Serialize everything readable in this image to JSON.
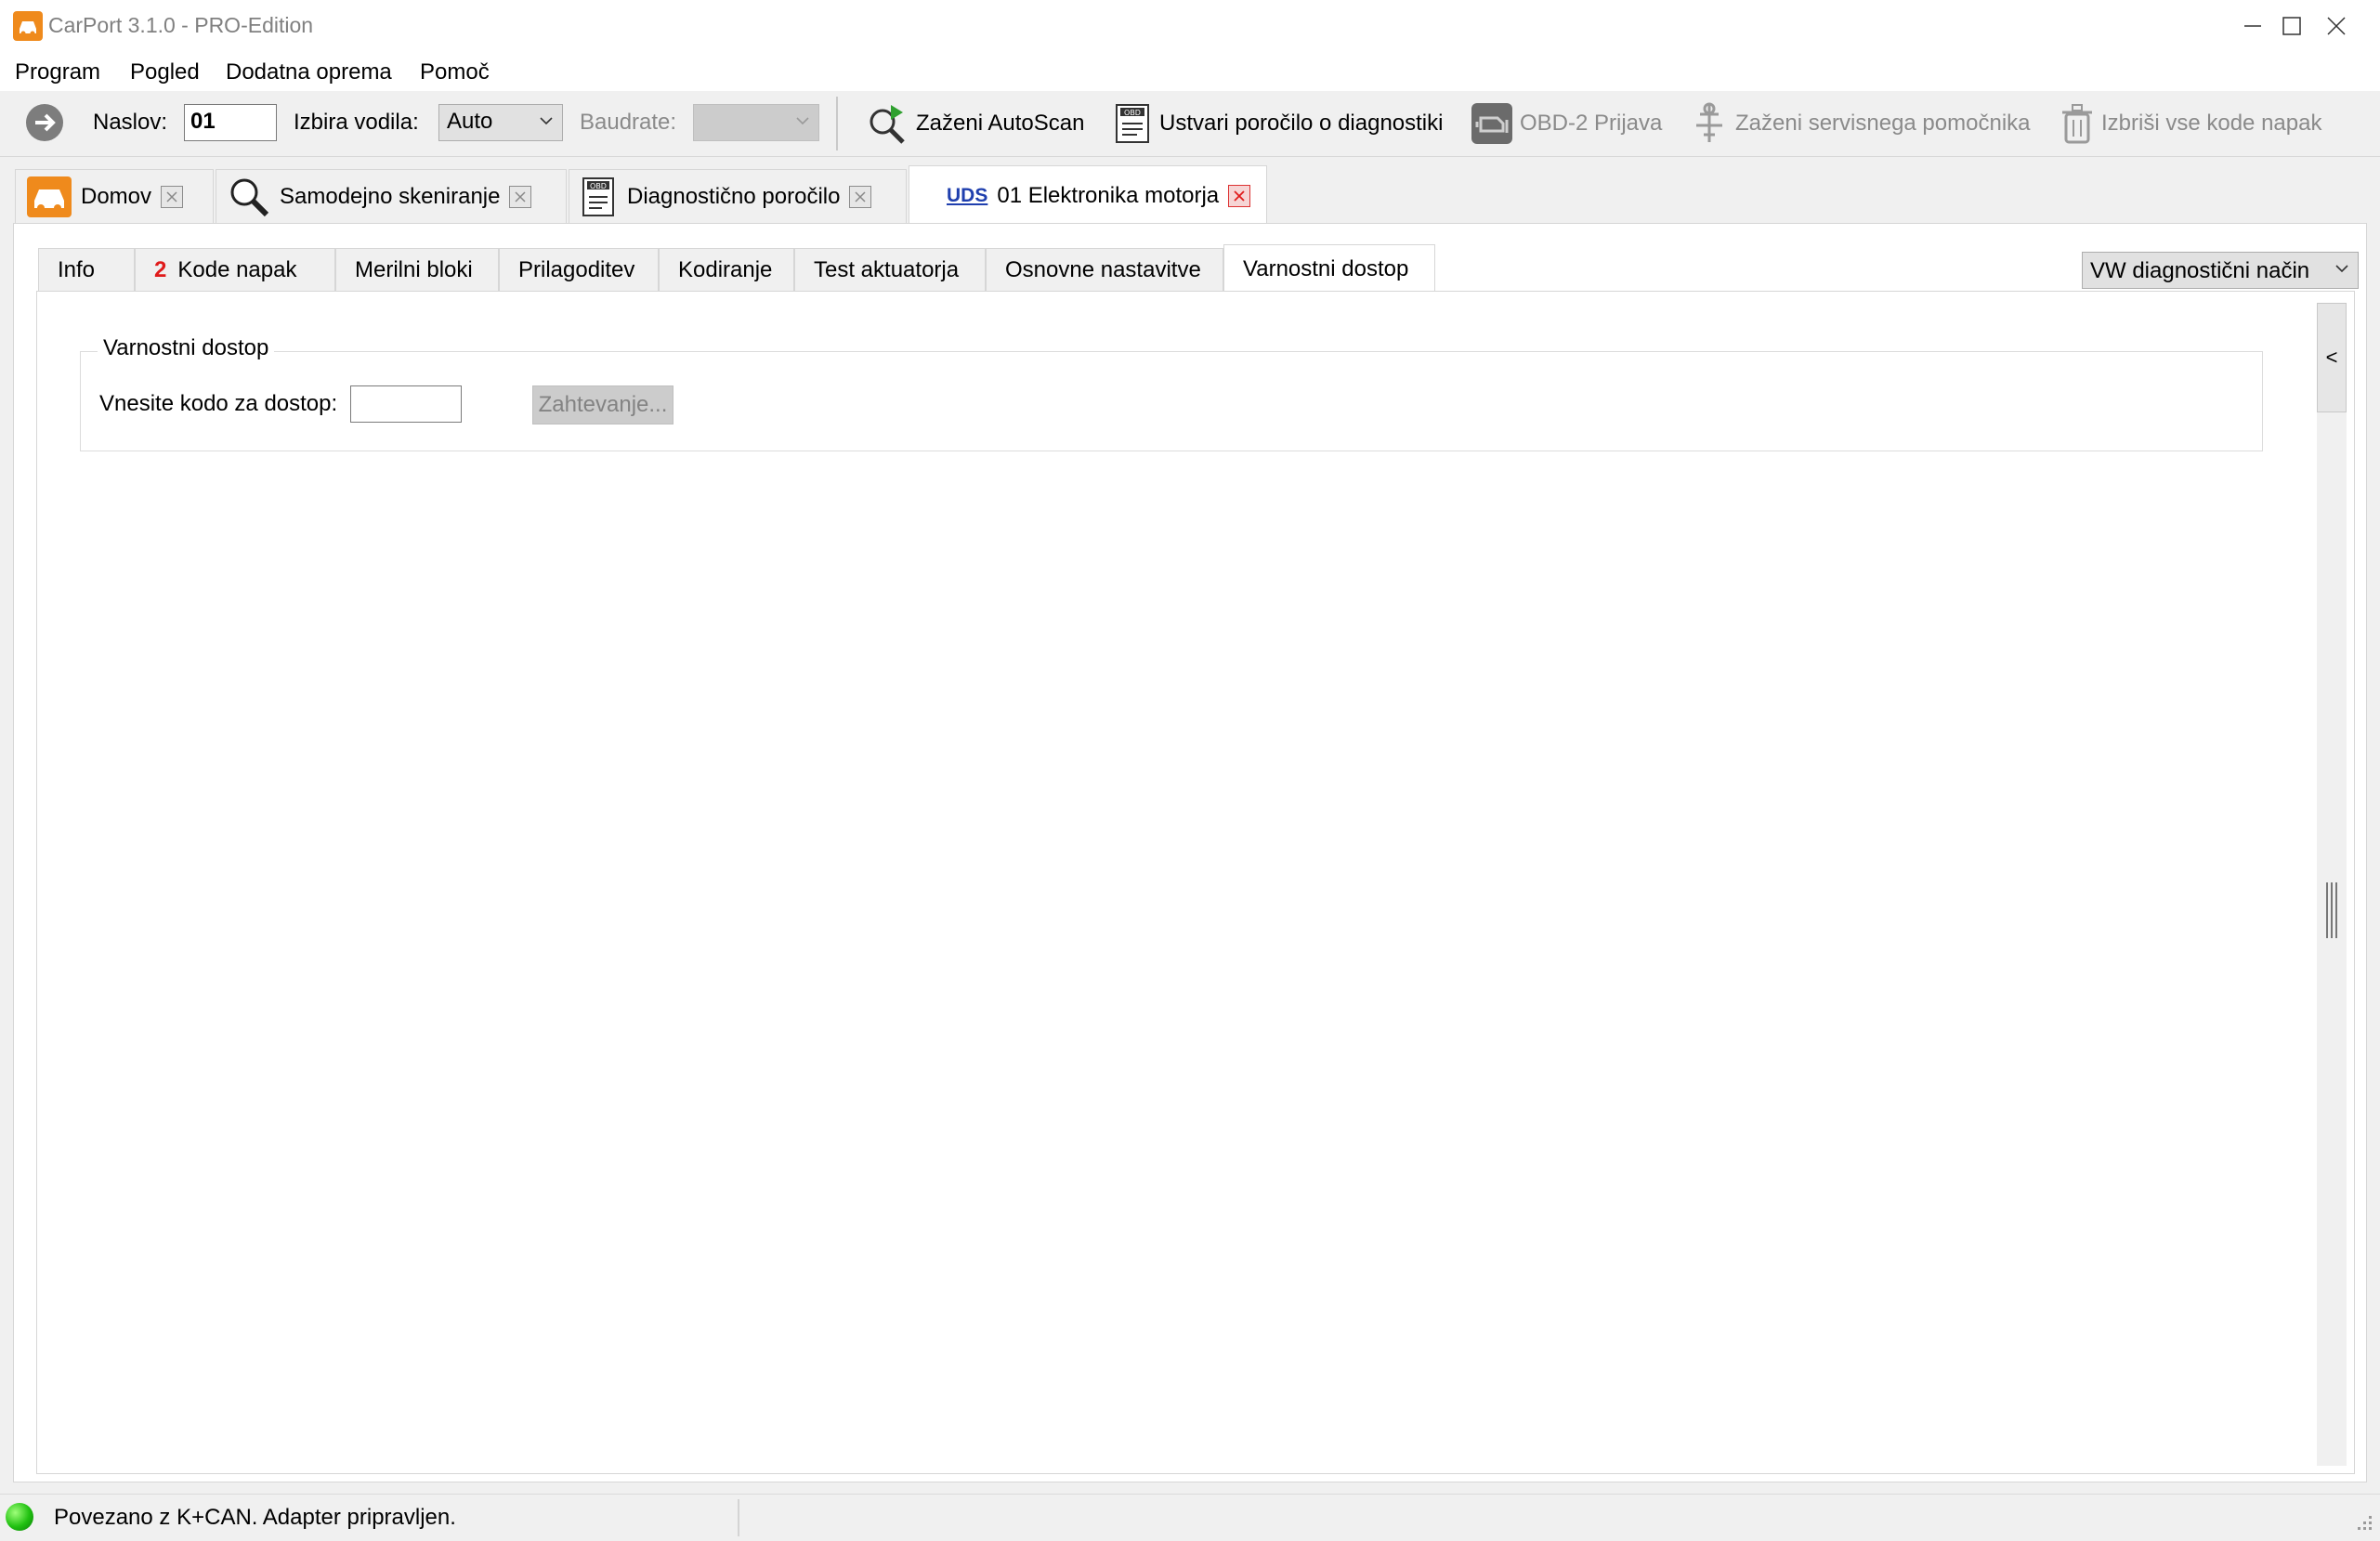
{
  "window": {
    "title": "CarPort 3.1.0 - PRO-Edition"
  },
  "menu": [
    "Program",
    "Pogled",
    "Dodatna oprema",
    "Pomoč"
  ],
  "toolbar": {
    "address_label": "Naslov:",
    "address_value": "01",
    "driver_label": "Izbira vodila:",
    "driver_value": "Auto",
    "baud_label": "Baudrate:",
    "baud_value": "",
    "buttons": {
      "autoscan": "Zaženi AutoScan",
      "report": "Ustvari poročilo o diagnostiki",
      "obd2": "OBD-2 Prijava",
      "service": "Zaženi servisnega pomočnika",
      "clear": "Izbriši vse kode napak"
    }
  },
  "doc_tabs": [
    {
      "label": "Domov"
    },
    {
      "label": "Samodejno skeniranje"
    },
    {
      "label": "Diagnostično poročilo",
      "badge": "OBD"
    },
    {
      "label": "01 Elektronika motorja",
      "badge": "UDS",
      "active": true
    }
  ],
  "sub_tabs": {
    "info": "Info",
    "codes_count": "2",
    "codes": "Kode napak",
    "measure": "Merilni bloki",
    "adapt": "Prilagoditev",
    "coding": "Kodiranje",
    "actuator": "Test aktuatorja",
    "basic": "Osnovne nastavitve",
    "security": "Varnostni dostop"
  },
  "mode_select": "VW diagnostični način",
  "security": {
    "group_title": "Varnostni dostop",
    "code_label": "Vnesite kodo za dostop:",
    "code_value": "",
    "request_button": "Zahtevanje..."
  },
  "side_button": "<",
  "status": {
    "text": "Povezano z K+CAN. Adapter pripravljen."
  },
  "colors": {
    "accent_orange": "#ef8a1c",
    "uds_blue": "#1f3fae",
    "error_red": "#e01b1b",
    "status_green": "#20c010"
  }
}
